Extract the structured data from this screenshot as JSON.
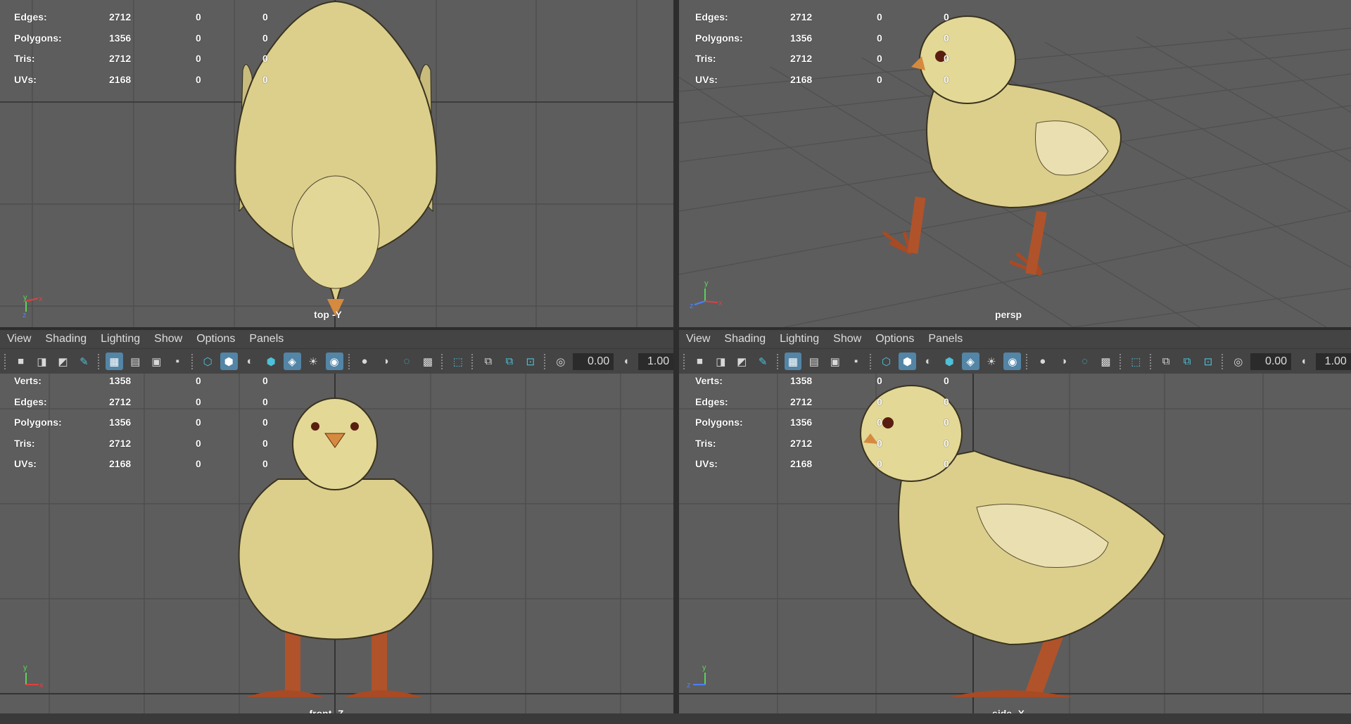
{
  "hud_labels": [
    "Verts:",
    "Edges:",
    "Polygons:",
    "Tris:",
    "UVs:"
  ],
  "stats": {
    "verts": [
      "1358",
      "0",
      "0"
    ],
    "edges": [
      "2712",
      "0",
      "0"
    ],
    "polygons": [
      "1356",
      "0",
      "0"
    ],
    "tris": [
      "2712",
      "0",
      "0"
    ],
    "uvs": [
      "2168",
      "0",
      "0"
    ]
  },
  "viewports": {
    "top": {
      "camera": "top -Y"
    },
    "persp": {
      "camera": "persp"
    },
    "front": {
      "camera": "front -Z"
    },
    "side": {
      "camera": "side -X"
    }
  },
  "panel_menu": [
    "View",
    "Shading",
    "Lighting",
    "Show",
    "Options",
    "Panels"
  ],
  "toolbar": {
    "exposure": "0.00",
    "gamma": "1.00",
    "icons": [
      "camera-icon",
      "camera-attributes-icon",
      "bookmark-icon",
      "image-plane-icon",
      "pencil-icon",
      "grid-icon",
      "film-gate-icon",
      "resolution-gate-icon",
      "gate-mask-icon",
      "wireframe-icon",
      "smooth-shade-icon",
      "wireframe-on-shaded-icon",
      "default-material-icon",
      "textured-icon",
      "use-all-lights-icon",
      "shadows-icon",
      "screen-space-ao-icon",
      "motion-blur-icon",
      "anti-aliasing-icon",
      "depth-of-field-icon",
      "isolate-select-icon",
      "xray-icon",
      "xray-joints-icon",
      "xray-components-icon",
      "exposure-icon",
      "gamma-icon"
    ]
  },
  "colors": {
    "viewport_bg": "#5d5d5d",
    "panel_bg": "#444444",
    "active_icon": "#5285a6",
    "chick_body": "#e3d896",
    "chick_leg": "#b0532a"
  }
}
